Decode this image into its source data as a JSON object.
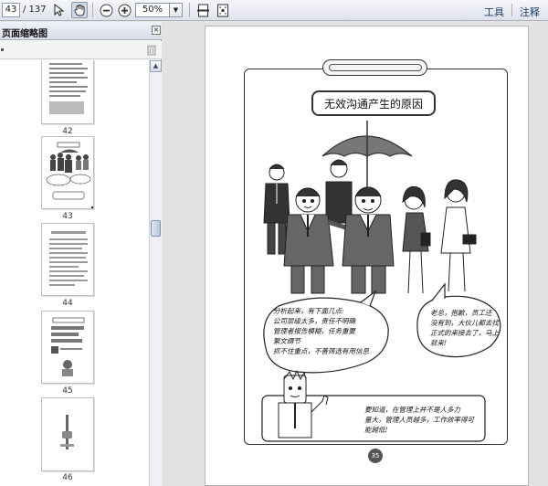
{
  "toolbar": {
    "page_current": "43",
    "page_total": "/ 137",
    "zoom_value": "50%",
    "tools_label": "工具",
    "comment_label": "注释",
    "icons": [
      "select-arrow-icon",
      "hand-icon",
      "zoom-out-icon",
      "zoom-in-icon",
      "fit-page-icon",
      "fit-width-icon"
    ]
  },
  "sidebar": {
    "title": "页面缩略图",
    "thumbnails": [
      {
        "label": "42"
      },
      {
        "label": "43"
      },
      {
        "label": "44"
      },
      {
        "label": "45"
      },
      {
        "label": "46"
      }
    ]
  },
  "document": {
    "title": "无效沟通产生的原因",
    "bubble_left": [
      "分析起来，有下面几点:",
      "公司层级太多，责任不明确",
      "管理者报告模糊，任务重要",
      "繁文缛节",
      "抓不住重点，不善筛选有用信息"
    ],
    "bubble_right": [
      "老总，抱歉，员工还",
      "没有到，大伙儿都去找",
      "正式的来接去了，马上",
      "就来!"
    ],
    "bottom_caption": [
      "要知道，在管理上并不是人多力",
      "量大，管理人员越多，工作效率得可",
      "能越低!"
    ],
    "page_number": "35"
  }
}
